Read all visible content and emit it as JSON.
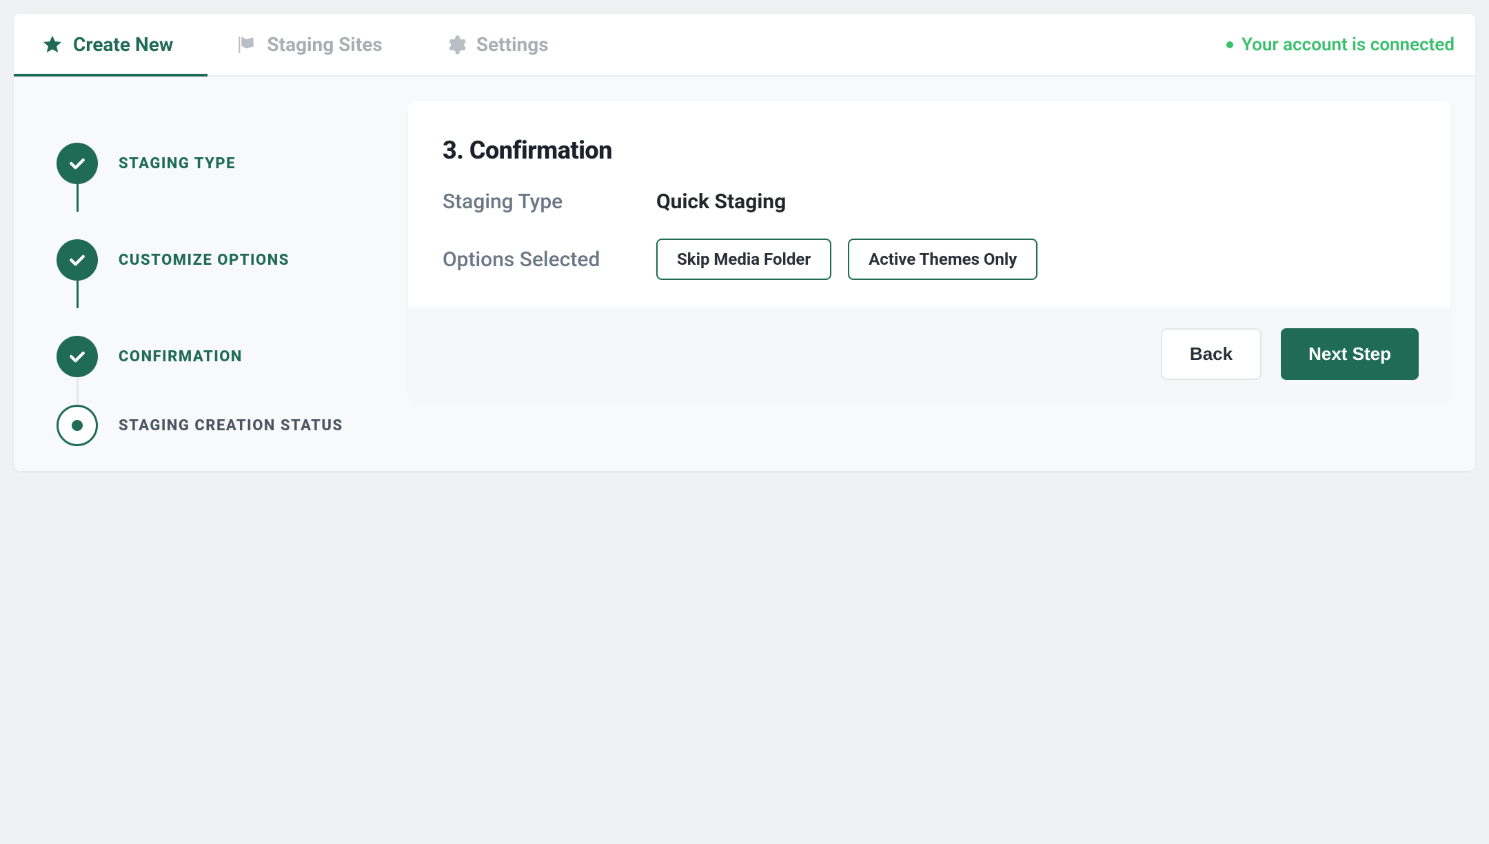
{
  "tabs": [
    {
      "label": "Create New",
      "icon": "star"
    },
    {
      "label": "Staging Sites",
      "icon": "flag"
    },
    {
      "label": "Settings",
      "icon": "gear"
    }
  ],
  "account_status": "Your account is connected",
  "steps": [
    {
      "label": "STAGING TYPE"
    },
    {
      "label": "CUSTOMIZE OPTIONS"
    },
    {
      "label": "CONFIRMATION"
    },
    {
      "label": "STAGING CREATION STATUS"
    }
  ],
  "panel": {
    "title": "3. Confirmation",
    "rows": {
      "staging_type_label": "Staging Type",
      "staging_type_value": "Quick Staging",
      "options_label": "Options Selected"
    },
    "chips": [
      "Skip Media Folder",
      "Active Themes Only"
    ],
    "buttons": {
      "back": "Back",
      "next": "Next Step"
    }
  }
}
